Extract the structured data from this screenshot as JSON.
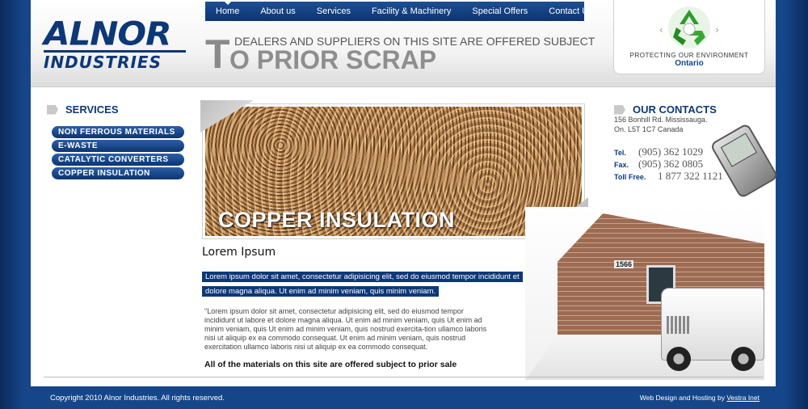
{
  "logo": {
    "top": "ALNOR",
    "bottom": "INDUSTRIES"
  },
  "nav": [
    {
      "label": "Home"
    },
    {
      "label": "About us"
    },
    {
      "label": "Services"
    },
    {
      "label": "Facility & Machinery"
    },
    {
      "label": "Special Offers"
    },
    {
      "label": "Contact Us"
    }
  ],
  "tagline": {
    "initial": "T",
    "line1": "DEALERS AND SUPPLIERS ON THIS SITE ARE OFFERED SUBJECT",
    "line2": "O PRIOR SCRAP"
  },
  "eco": {
    "icon": "recycle-icon",
    "text": "PROTECTING OUR ENVIRONMENT",
    "region": "Ontario",
    "accent_green": "#2e9a2a"
  },
  "services": {
    "title": "SERVICES",
    "items": [
      {
        "label": "NON FERROUS MATERIALS"
      },
      {
        "label": "E-WASTE"
      },
      {
        "label": "CATALYTIC CONVERTERS"
      },
      {
        "label": "COPPER INSULATION"
      }
    ]
  },
  "banner": {
    "label": "COPPER INSULATION"
  },
  "content": {
    "heading": "Lorem Ipsum",
    "highlight": "Lorem ipsum dolor sit amet, consectetur adipisicing elit, sed do eiusmod tempor incididunt et dolore magna aliqua. Ut enim ad minim veniam, quis minim veniam.",
    "body": "\"Lorem ipsum dolor sit amet, consectetur adipisicing elit, sed do eiusmod tempor incididunt ut labore et dolore magna aliqua. Ut enim ad minim veniam, quis  Ut enim ad minim veniam, quis  Ut enim ad minim veniam, quis nostrud exercita-tion ullamco laboris nisi ut aliquip ex ea commodo consequat. Ut enim ad minim veniam, quis nostrud exercitation ullamco laboris nisi ut aliquip ex ea commodo consequat.",
    "note": "All of the materials on this site are offered subject to prior sale"
  },
  "contacts": {
    "title": "OUR CONTACTS",
    "address_line1": "156 Bonhill Rd. Mississauga.",
    "address_line2": "On. L5T 1C7 Canada",
    "tel_label": "Tel.",
    "tel": "(905) 362 1029",
    "fax_label": "Fax.",
    "fax": "(905) 362 0805",
    "tollfree_label": "Toll Free.",
    "tollfree": "1 877 322 1121"
  },
  "building": {
    "number": "1566"
  },
  "footer": {
    "copyright": "Copyright 2010 Alnor Industries. All rights reserved.",
    "credit_prefix": "Web Design and Hosting by ",
    "credit_link": "Vestra Inet"
  },
  "colors": {
    "brand_blue": "#0d3878",
    "background_blue": "#16468a"
  }
}
